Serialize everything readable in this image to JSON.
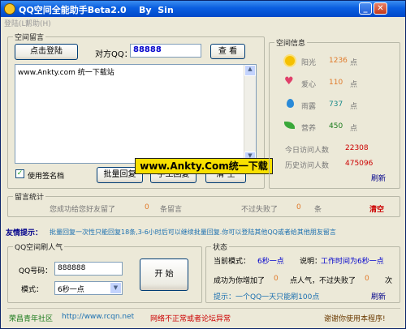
{
  "window": {
    "title": "QQ空间全能助手Beta2.0    By  Sin"
  },
  "menu": {
    "items": [
      "登陆(L)",
      "帮助(H)"
    ]
  },
  "space_msg": {
    "group_title": "空间留言",
    "login_button": "点击登陆",
    "target_qq_label": "对方QQ：",
    "target_qq_value": "88888",
    "view_button": "查  看",
    "message_text": "www.Ankty.com 统一下载站",
    "signature_label": "使用签名档",
    "batch_reply_button": "批量回复",
    "manual_reply_button": "手工回复",
    "clear_button": "清  空"
  },
  "watermark": "www.Ankty.Com统一下载",
  "space_info": {
    "group_title": "空间信息",
    "stats": [
      {
        "icon": "sun-icon",
        "label": "阳光",
        "value": "1236",
        "unit": "点",
        "color": "#e07a2a"
      },
      {
        "icon": "heart-icon",
        "label": "爱心",
        "value": "110",
        "unit": "点",
        "color": "#e07a2a"
      },
      {
        "icon": "raindrop-icon",
        "label": "雨露",
        "value": "737",
        "unit": "点",
        "color": "#1a8a8a"
      },
      {
        "icon": "leaf-icon",
        "label": "营养",
        "value": "450",
        "unit": "点",
        "color": "#1a7a1a"
      }
    ],
    "today_visits_label": "今日访问人数",
    "today_visits": "22308",
    "history_visits_label": "历史访问人数",
    "history_visits": "475096",
    "refresh": "刷新"
  },
  "msg_stats": {
    "group_title": "留言统计",
    "success_prefix": "您成功给您好友留了",
    "success_count": "0",
    "success_suffix": "条留言",
    "fail_prefix": "不过失败了",
    "fail_count": "0",
    "fail_suffix": "条",
    "clear_link": "清空"
  },
  "tip": {
    "label": "友情提示：",
    "text": "批量回复一次性只能回复18条,3-6小时后可以继续批量回复.你可以登陆其他QQ或者给其他朋友留言"
  },
  "popularity": {
    "group_title": "QQ空间刷人气",
    "qq_label": "QQ号码：",
    "qq_value": "888888",
    "mode_label": "模式：",
    "mode_value": "6秒一点",
    "start_button": "开  始"
  },
  "status": {
    "group_title": "状态",
    "mode_label": "当前模式：",
    "mode_value": "6秒一点",
    "desc_label": "说明：",
    "desc_value": "工作时间为6秒一点",
    "added_prefix": "成功为你增加了",
    "added_count": "0",
    "added_suffix": "点人气，不过失败了",
    "failed_count": "0",
    "failed_suffix": "次",
    "tip": "提示：一个QQ一天只能刷100点",
    "refresh": "刷新"
  },
  "footer": {
    "community": "荣昌青年社区",
    "url": "http://www.rcqn.net",
    "error": "网络不正常或者论坛异常",
    "thanks": "谢谢你使用本程序!"
  }
}
